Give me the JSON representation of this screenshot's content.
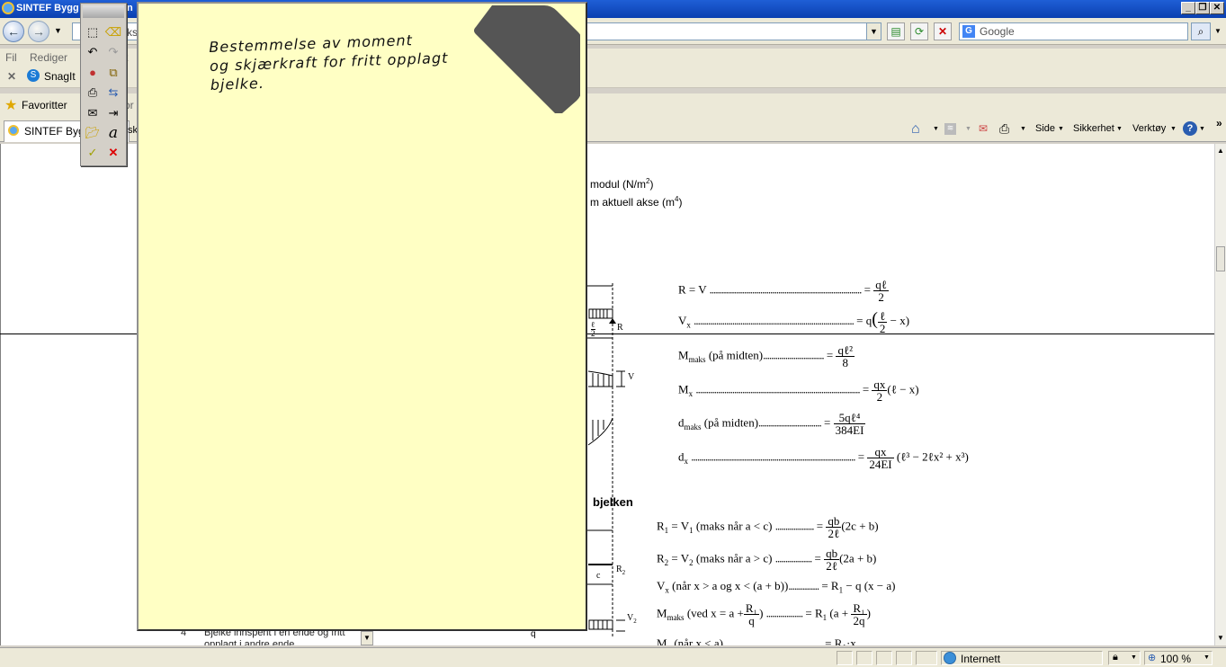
{
  "window": {
    "title": "SINTEF Bygg",
    "title_suffix": "n"
  },
  "navbar": {
    "address_partial": "ks",
    "search_placeholder": "Google"
  },
  "menubar": {
    "items": [
      "Fil",
      "Rediger"
    ],
    "snagit_label": "SnagIt",
    "favorites_label": "Favoritter",
    "tab_title": "SINTEF Bygg",
    "tab_suffix": "sk",
    "linkbar_partial_1": "t",
    "linkbar_partial_2": "or"
  },
  "commandbar": {
    "side": "Side",
    "sikkerhet": "Sikkerhet",
    "verktoy": "Verktøy"
  },
  "note": {
    "line1": "Bestemmelse av moment",
    "line2": "og skjærkraft for fritt opplagt",
    "line3": "bjelke."
  },
  "content": {
    "text_modul": "modul (N/m",
    "text_modul_sup": "2",
    "text_modul_end": ")",
    "text_akse": "m aktuell akse (m",
    "text_akse_sup": "4",
    "text_akse_end": ")",
    "heading_bjelken": "bjelken",
    "bottom_item_no": "4",
    "bottom_item_text": "Bjelke innspent i en ende og fritt opplagt i andre ende",
    "diagram_labels": {
      "r": "R",
      "v": "V",
      "c": "c",
      "r2": "R",
      "r2_sub": "2",
      "v2": "V",
      "v2_sub": "2",
      "q": "q",
      "l2_num": "ℓ",
      "l2_den": "2"
    }
  },
  "formulas_1": [
    {
      "lhs": "R = V",
      "rhs_prefix": "= ",
      "num": "qℓ",
      "den": "2",
      "tail": ""
    },
    {
      "lhs": "V",
      "lhs_sub": "x",
      "rhs_prefix": "= q",
      "num": "ℓ",
      "den": "2",
      "tail": "− x)",
      "open": "(",
      "dots": "........................................................................................."
    },
    {
      "lhs": "M",
      "lhs_sub": "maks",
      "lhs_tail": "(på midten)",
      "rhs_prefix": "= ",
      "num": "qℓ²",
      "den": "8",
      "tail": ""
    },
    {
      "lhs": "M",
      "lhs_sub": "x",
      "rhs_prefix": "= ",
      "num": "qx",
      "den": "2",
      "tail": "(ℓ − x)"
    },
    {
      "lhs": "d",
      "lhs_sub": "maks",
      "lhs_tail": "(på midten)",
      "rhs_prefix": "= ",
      "num": "5qℓ⁴",
      "den": "384EI",
      "tail": ""
    },
    {
      "lhs": "d",
      "lhs_sub": "x",
      "rhs_prefix": "= ",
      "num": "qx",
      "den": "24EI",
      "tail": "(ℓ³ − 2ℓx² + x³)"
    }
  ],
  "formulas_2": [
    {
      "lhs": "R",
      "lhs_sub": "1",
      "mid": " = V",
      "mid_sub": "1",
      "cond": "(maks når a < c)",
      "rhs_prefix": "= ",
      "num": "qb",
      "den": "2ℓ",
      "tail": "(2c + b)"
    },
    {
      "lhs": "R",
      "lhs_sub": "2",
      "mid": " = V",
      "mid_sub": "2",
      "cond": "(maks når a > c)",
      "rhs_prefix": "= ",
      "num": "qb",
      "den": "2ℓ",
      "tail": "(2a + b)"
    },
    {
      "lhs": "V",
      "lhs_sub": "x",
      "mid": "",
      "mid_sub": "",
      "cond": "(når x > a og x < (a + b))",
      "rhs_prefix": "= R",
      "rhs_sub": "1",
      "rhs_tail": " − q (x − a)"
    },
    {
      "lhs": "M",
      "lhs_sub": "maks",
      "mid": "",
      "mid_sub": "",
      "cond": "(ved x = a +",
      "cond_num": "R₁",
      "cond_den": "q",
      "cond_end": ")",
      "rhs_prefix": "= R",
      "rhs_sub": "1",
      "rhs_tail": " (a +",
      "num": "R₁",
      "den": "2q",
      "tail": ")"
    },
    {
      "lhs": "M",
      "lhs_sub": "x",
      "mid": "",
      "mid_sub": "",
      "cond": "(når x < a)",
      "rhs_prefix": "= R",
      "rhs_sub": "1",
      "rhs_tail": "·x"
    }
  ],
  "statusbar": {
    "zone": "Internett",
    "zoom": "100 %"
  },
  "icons": [
    "ie-logo-icon",
    "back-icon",
    "forward-icon",
    "refresh-icon",
    "stop-icon",
    "search-icon",
    "home-icon",
    "rss-icon",
    "mail-icon",
    "print-icon",
    "help-icon",
    "globe-icon",
    "zoom-icon",
    "star-icon",
    "snagit-icon"
  ],
  "colors": {
    "note_bg": "#ffffc4",
    "note_tab": "#555555",
    "titlebar": "#0a3fb0"
  }
}
